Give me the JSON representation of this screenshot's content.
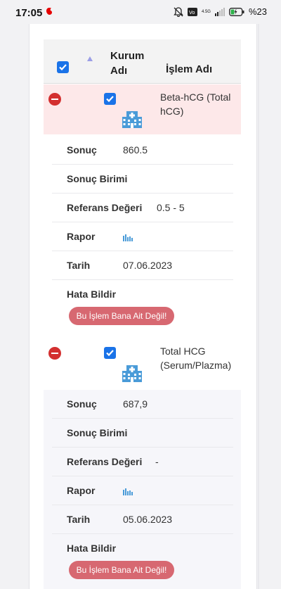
{
  "status_bar": {
    "time": "17:05",
    "battery": "%23",
    "network": "4.5G"
  },
  "table": {
    "header": {
      "col_kurum": "Kurum Adı",
      "col_kurum_l1": "Kurum",
      "col_kurum_l2": "Adı",
      "col_islem": "İşlem Adı"
    },
    "rows": [
      {
        "islem_l1": "Beta-hCG (Total",
        "islem_l2": "hCG)",
        "details": {
          "sonuc_label": "Sonuç",
          "sonuc_value": "860.5",
          "birim_label": "Sonuç Birimi",
          "birim_value": "",
          "referans_label": "Referans Değeri",
          "referans_value": "0.5 - 5",
          "rapor_label": "Rapor",
          "tarih_label": "Tarih",
          "tarih_value": "07.06.2023",
          "hata_label": "Hata Bildir",
          "hata_button": "Bu İşlem Bana Ait Değil!"
        }
      },
      {
        "islem_l1": "Total HCG",
        "islem_l2": "(Serum/Plazma)",
        "details": {
          "sonuc_label": "Sonuç",
          "sonuc_value": "687,9",
          "birim_label": "Sonuç Birimi",
          "birim_value": "",
          "referans_label": "Referans Değeri",
          "referans_value": "-",
          "rapor_label": "Rapor",
          "tarih_label": "Tarih",
          "tarih_value": "05.06.2023",
          "hata_label": "Hata Bildir",
          "hata_button": "Bu İşlem Bana Ait Değil!"
        }
      }
    ]
  },
  "icons": {
    "select_all": "checkbox-icon",
    "sort": "sort-asc-icon",
    "remove": "minus-circle-icon",
    "institution": "hospital-icon",
    "report": "bar-chart-icon"
  },
  "colors": {
    "accent": "#1a73e8",
    "danger": "#d32f2f",
    "error_button": "#d76871",
    "selected_row": "#fde8e9",
    "icon_blue": "#4a9bd8"
  }
}
